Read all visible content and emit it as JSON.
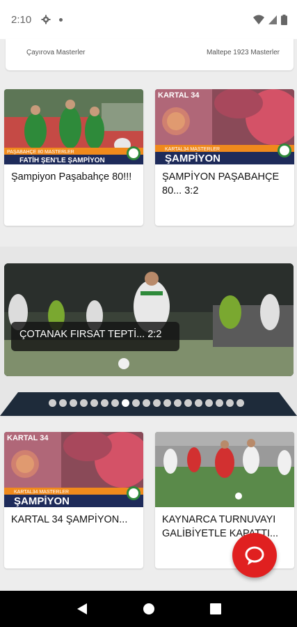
{
  "status_bar": {
    "time": "2:10"
  },
  "top_card": {
    "left_team": "Çayırova Masterler",
    "right_team": "Maltepe 1923 Masterler"
  },
  "cards_row1": [
    {
      "title": "Şampiyon Paşabahçe 80!!!",
      "banner_small": "PAŞABAHÇE 80 MASTERLER",
      "banner_big": "FATİH ŞEN'LE ŞAMPİYON"
    },
    {
      "title": "ŞAMPİYON PAŞABAHÇE 80... 3:2",
      "badge": "KARTAL 34",
      "banner_small": "KARTAL34 MASTERLER",
      "banner_big": "ŞAMPİYON"
    }
  ],
  "hero": {
    "caption": "ÇOTANAK FIRSAT TEPTİ... 2:2"
  },
  "carousel": {
    "count": 19,
    "active_index": 7
  },
  "cards_row2": [
    {
      "title": "KARTAL 34 ŞAMPİYON...",
      "badge": "KARTAL 34",
      "banner_small": "KARTAL34 MASTERLER",
      "banner_big": "ŞAMPİYON"
    },
    {
      "title": "KAYNARCA TURNUVAYI GALİBİYETLE KAPATTI..."
    }
  ],
  "colors": {
    "accent": "#e02020",
    "banner_blue": "#1e2b5a",
    "banner_orange": "#f08a1c"
  }
}
